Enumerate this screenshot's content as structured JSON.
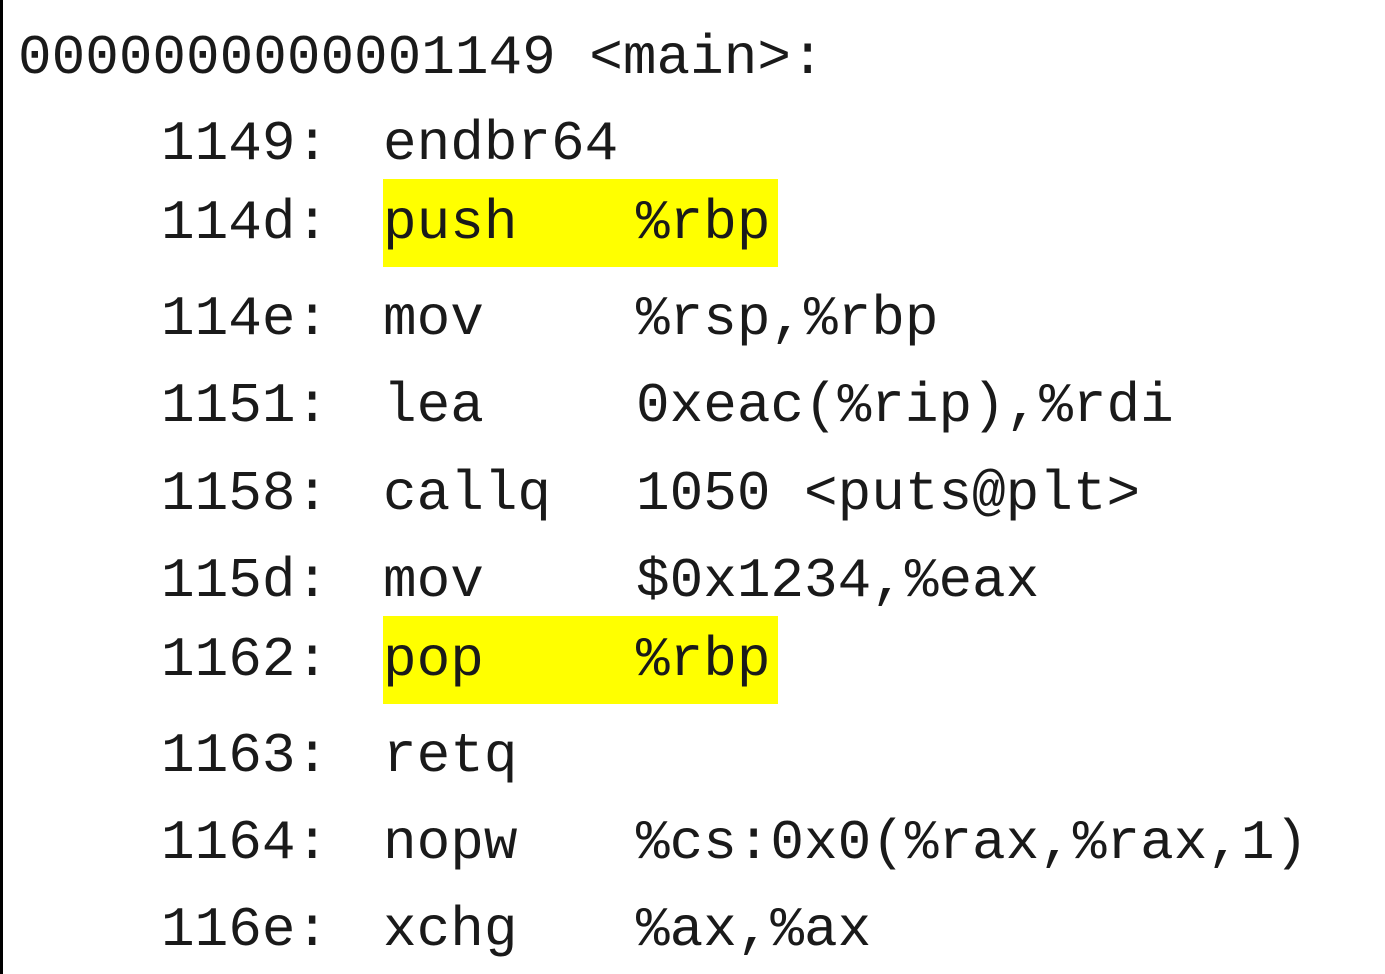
{
  "function": {
    "header": "0000000000001149 <main>:"
  },
  "highlight_color": "#ffff00",
  "instructions": [
    {
      "address": "1149:",
      "mnemonic": "endbr64",
      "operands": "",
      "highlighted": false
    },
    {
      "address": "114d:",
      "mnemonic": "push",
      "operands": "%rbp",
      "highlighted": true
    },
    {
      "address": "114e:",
      "mnemonic": "mov",
      "operands": "%rsp,%rbp",
      "highlighted": false
    },
    {
      "address": "1151:",
      "mnemonic": "lea",
      "operands": "0xeac(%rip),%rdi",
      "highlighted": false
    },
    {
      "address": "1158:",
      "mnemonic": "callq",
      "operands": "1050 <puts@plt>",
      "highlighted": false
    },
    {
      "address": "115d:",
      "mnemonic": "mov",
      "operands": "$0x1234,%eax",
      "highlighted": false
    },
    {
      "address": "1162:",
      "mnemonic": "pop",
      "operands": "%rbp",
      "highlighted": true
    },
    {
      "address": "1163:",
      "mnemonic": "retq",
      "operands": "",
      "highlighted": false
    },
    {
      "address": "1164:",
      "mnemonic": "nopw",
      "operands": "%cs:0x0(%rax,%rax,1)",
      "highlighted": false
    },
    {
      "address": "116e:",
      "mnemonic": "xchg",
      "operands": "%ax,%ax",
      "highlighted": false
    }
  ]
}
